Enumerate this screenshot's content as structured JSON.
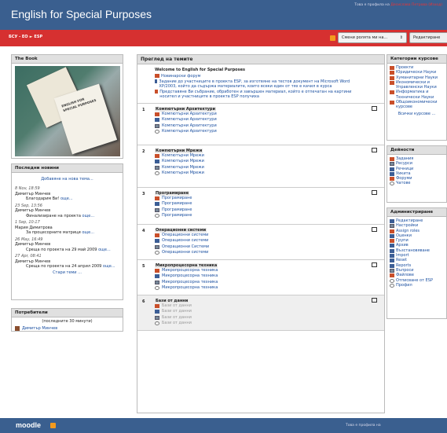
{
  "header": {
    "title": "English for Special Purposes",
    "login_text": "Това е профила на",
    "login_user": "Десислава Петрова",
    "login_link": "(Изход)"
  },
  "nav": {
    "crumb1": "БСУ - ЕО",
    "crumb_sep": "►",
    "crumb2": "ESP",
    "role_select": "Смени ролята ми на...",
    "edit_button": "Редактиране"
  },
  "book": {
    "title": "The Book",
    "cover_text": "ENGLISH FOR SPECIAL PURPOSES"
  },
  "news": {
    "title": "Последни новини",
    "add": "Добавяне на нова тема...",
    "items": [
      {
        "date": "8 Nov, 18:59",
        "author": "Димитър Минчев",
        "text": "Благодарим Ви!",
        "more": "още..."
      },
      {
        "date": "23 Sep, 13:56",
        "author": "Димитър Минчев",
        "text": "Финализиране на проекта",
        "more": "още..."
      },
      {
        "date": "1 Sep, 10:17",
        "author": "Мария Димитрова",
        "text": "За процесорните матрици",
        "more": "още..."
      },
      {
        "date": "26 May, 16:49",
        "author": "Димитър Минчев",
        "text": "Среща по проекта на 29 май 2009",
        "more": "още..."
      },
      {
        "date": "27 Apr, 08:41",
        "author": "Димитър Минчев",
        "text": "Среща по проекта на 24 април 2009",
        "more": "още..."
      }
    ],
    "older": "Стари теми ..."
  },
  "users": {
    "title": "Потребители",
    "line": "(последните 30 минути)",
    "user": "Димитър Минчев"
  },
  "main": {
    "title": "Преглед на темите",
    "welcome": "Welcome to English for Special Purposes",
    "intro_items": [
      "Новинарски форум",
      "Задание до участниците в проекта ESP, за изготвяне на тестов документ на Microsoft Word XP/2003, който да съдържа материалите, които всеки един от тях е качил в курса",
      "Представяне Ви събрание, обработен и завършен материал, който е отпечатан на картини носител и участниците в проекта ESP получиха"
    ]
  },
  "topics": [
    {
      "num": "1",
      "title": "Компютърни Архитектури",
      "acts": [
        "Компютърни Архитектури",
        "Компютърни Архитектури",
        "Компютърни Архитектури",
        "Компютърни Архитектури"
      ]
    },
    {
      "num": "2",
      "title": "Компютърни Мрежи",
      "acts": [
        "Компютърни Мрежи",
        "Компютърни Мрежи",
        "Компютърни Мрежи",
        "Компютърни Мрежи"
      ]
    },
    {
      "num": "3",
      "title": "Програмиране",
      "acts": [
        "Програмиране",
        "Програмиране",
        "Програмиране",
        "Програмиране"
      ]
    },
    {
      "num": "4",
      "title": "Операционни системи",
      "acts": [
        "Операционни системи",
        "Операционни системи",
        "Операционни Системи",
        "Операционни системи"
      ]
    },
    {
      "num": "5",
      "title": "Микропроцесорна техника",
      "acts": [
        "Микропроцесорна техника",
        "Микропроцесорна техника",
        "Микропроцесорна техника",
        "Микропроцесорна техника"
      ]
    },
    {
      "num": "6",
      "title": "Бази от данни",
      "acts": [
        "Бази от данни",
        "Бази от данни",
        "Бази от данни",
        "Бази от данни"
      ]
    }
  ],
  "categories": {
    "title": "Категории курсове",
    "items": [
      "Проекти",
      "Юридически Науки",
      "Хуманитарни Науки",
      "Икономически и Управленски Науки",
      "Информатика и Технически Науки",
      "Общоикономически курсове"
    ],
    "all": "Всички курсове ..."
  },
  "activities": {
    "title": "Дейности",
    "items": [
      "Задания",
      "Ресурси",
      "Речници",
      "Уикита",
      "Форуми",
      "Чатове"
    ]
  },
  "admin": {
    "title": "Администриране",
    "items": [
      "Редактиране",
      "Настройки",
      "Assign roles",
      "Оценки",
      "Групи",
      "Архив",
      "Възстановяване",
      "Import",
      "Reset",
      "Reports",
      "Въпроси",
      "Файлове",
      "Отписване от ESP",
      "Профил"
    ]
  },
  "footer": {
    "logo": "moodle",
    "info": "Това е профила на"
  },
  "colors": {
    "header": "#3a5f8f",
    "navbar": "#d63030"
  }
}
